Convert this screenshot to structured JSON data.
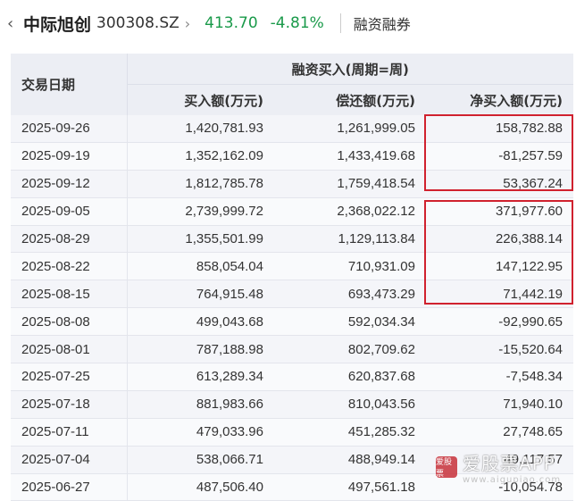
{
  "header": {
    "back_icon": "chevron-left",
    "stock_name": "中际旭创",
    "stock_code": "300308.SZ",
    "chevron_icon": "chevron-right",
    "price": "413.70",
    "change_pct": "-4.81%",
    "tab_label": "融资融券",
    "price_color": "#1a9a4a"
  },
  "table": {
    "date_header": "交易日期",
    "group_header": "融资买入(周期=周)",
    "columns": [
      "买入额(万元)",
      "偿还额(万元)",
      "净买入额(万元)"
    ],
    "rows": [
      {
        "date": "2025-09-26",
        "buy": "1,420,781.93",
        "repay": "1,261,999.05",
        "net": "158,782.88"
      },
      {
        "date": "2025-09-19",
        "buy": "1,352,162.09",
        "repay": "1,433,419.68",
        "net": "-81,257.59"
      },
      {
        "date": "2025-09-12",
        "buy": "1,812,785.78",
        "repay": "1,759,418.54",
        "net": "53,367.24"
      },
      {
        "date": "2025-09-05",
        "buy": "2,739,999.72",
        "repay": "2,368,022.12",
        "net": "371,977.60"
      },
      {
        "date": "2025-08-29",
        "buy": "1,355,501.99",
        "repay": "1,129,113.84",
        "net": "226,388.14"
      },
      {
        "date": "2025-08-22",
        "buy": "858,054.04",
        "repay": "710,931.09",
        "net": "147,122.95"
      },
      {
        "date": "2025-08-15",
        "buy": "764,915.48",
        "repay": "693,473.29",
        "net": "71,442.19"
      },
      {
        "date": "2025-08-08",
        "buy": "499,043.68",
        "repay": "592,034.34",
        "net": "-92,990.65"
      },
      {
        "date": "2025-08-01",
        "buy": "787,188.98",
        "repay": "802,709.62",
        "net": "-15,520.64"
      },
      {
        "date": "2025-07-25",
        "buy": "613,289.34",
        "repay": "620,837.68",
        "net": "-7,548.34"
      },
      {
        "date": "2025-07-18",
        "buy": "881,983.66",
        "repay": "810,043.56",
        "net": "71,940.10"
      },
      {
        "date": "2025-07-11",
        "buy": "479,033.96",
        "repay": "451,285.32",
        "net": "27,748.65"
      },
      {
        "date": "2025-07-04",
        "buy": "538,066.71",
        "repay": "488,949.14",
        "net": "49,117.57"
      },
      {
        "date": "2025-06-27",
        "buy": "487,506.40",
        "repay": "497,561.18",
        "net": "-10,054.78"
      }
    ],
    "highlight_color": "#d0212e"
  },
  "watermark": {
    "logo_text": "爱股票",
    "title": "爱股票APP",
    "url": "www.aigupiao.com"
  }
}
